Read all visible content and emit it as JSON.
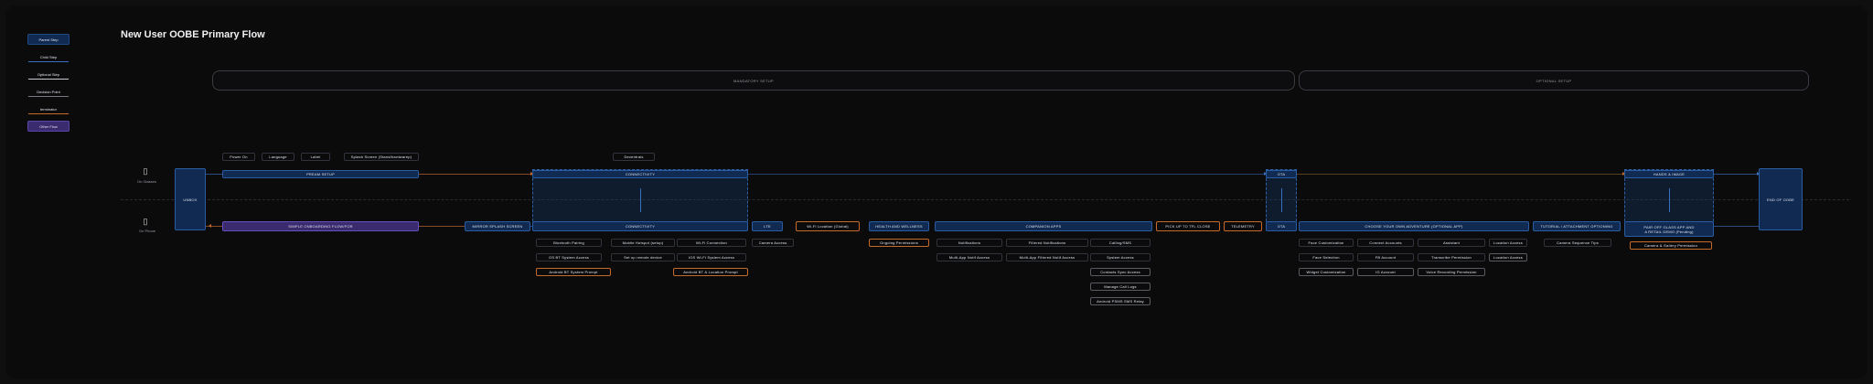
{
  "title": "New User OOBE Primary Flow",
  "legend": {
    "primary": "Parent Step",
    "child": "Child Step",
    "optional": "Optional Step",
    "decision": "Decision Point",
    "terminator": "terminator",
    "other": "Other Flow"
  },
  "brackets": {
    "mandatory": "MANDATORY SETUP",
    "optional": "OPTIONAL SETUP"
  },
  "devices": {
    "glasses_label": "On Glasses",
    "phone_label": "On Phone"
  },
  "unbox": "UNBOX",
  "end": "END OF OOBE",
  "glasses_row": {
    "pre_setup_children": [
      "Power On",
      "Language",
      "Label",
      "Splash Screen (Stand/hardwarep)"
    ],
    "pre_setup": "PREAM SETUP",
    "connectivity_top": "Decentrals",
    "connectivity": "CONNECTIVITY",
    "ota": "OTA",
    "tutorial": "HANDS & IMAGE"
  },
  "phone_row": {
    "simple_onboarding": "SIMPLE ONBOARDING FLOW/FOR",
    "splash": "MIRROR SPLASH SCREEN",
    "connectivity": "CONNECTIVITY",
    "connectivity_children": [
      [
        "Bluetooth Pairing",
        "OS BT System Access",
        "Android BT System Prompt"
      ],
      [
        "Mobile Hotspot (setup)",
        "Set up remote device"
      ],
      [
        "Wi-Fi Connection",
        "IOS Wi-Fi System Access",
        "Android BT & Location Prompt"
      ]
    ],
    "lte": "LTE",
    "lte_children": [
      "Camera Access"
    ],
    "wifi_location": "Wi-Fi Location (Global)",
    "health": "HEALTH AND WELLNESS",
    "health_children": [
      "Ongoing Permissions"
    ],
    "companion": "COMPANION APPS",
    "companion_children": [
      [
        "Notifications",
        "Multi-App Notif Access"
      ],
      [
        "Filtered Notifications",
        "Multi-App Filtered Notif Access"
      ],
      [
        "Calling/SMS",
        "System Access",
        "Contacts Sync Access",
        "Manage Call Logs",
        "Android PSMS SMS Relay"
      ]
    ],
    "pick_up": "PICK UP TO TFL CLOSE",
    "telemetry": "TELEMETRY",
    "ota": "OTA",
    "choose_adventure": "CHOOSE YOUR OWN ADVENTURE (OPTIONAL APP)",
    "choose_children": [
      [
        "Face Customization",
        "Face Selection",
        "Widget Customization"
      ],
      [
        "Connect Accounts",
        "FB Account",
        "IG Account"
      ],
      [
        "Assistant",
        "Transcribe Permission",
        "Voice Recording Permission"
      ],
      [
        "Location Access",
        "Location Access"
      ]
    ],
    "tutorial": "TUTORIAL / ATTACHMENT OPTIONING",
    "tutorial_children": [
      "Camera Sequence Tips"
    ],
    "pair_box": "PAIR OFF GLASS APP AND\nA RETAIL DEMO (Pending)",
    "pair_children": [
      "Camera & Gallery Permission"
    ]
  },
  "colors": {
    "primary_fill": "#102a52",
    "primary_border": "#2a5ca3",
    "other_fill": "#3a2a6e",
    "terminator": "#c46a2a",
    "background": "#0b0b0c"
  }
}
